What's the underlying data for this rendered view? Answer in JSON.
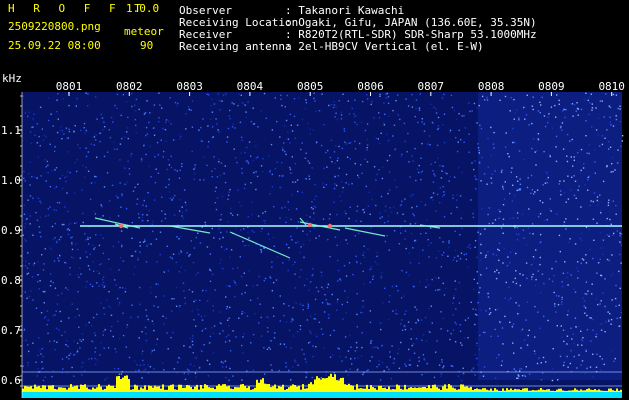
{
  "header": {
    "app_title": "H R O F F T",
    "version": "1.0.0",
    "filename": "2509220800.png",
    "datetime": "25.09.22 08:00",
    "mode": "meteor",
    "count": "90"
  },
  "info": {
    "observer_label": "Observer",
    "observer_value": ": Takanori Kawachi",
    "location_label": "Receiving Location",
    "location_value": ": Ogaki, Gifu, JAPAN (136.60E, 35.35N)",
    "receiver_label": "Receiver",
    "receiver_value": ": R820T2(RTL-SDR) SDR-Sharp 53.1000MHz",
    "antenna_label": "Receiving antenna",
    "antenna_value": ": 2el-HB9CV Vertical (el. E-W)"
  },
  "axes": {
    "y_unit": "kHz",
    "y_ticks": [
      "1.1",
      "1.0",
      "0.9",
      "0.8",
      "0.7",
      "0.6"
    ],
    "x_ticks": [
      "0801",
      "0802",
      "0803",
      "0804",
      "0805",
      "0806",
      "0807",
      "0808",
      "0809",
      "0810"
    ]
  },
  "colors": {
    "background": "#000000",
    "noise": "#0a1f8c",
    "carrier": "#a8ffff",
    "level_bar": "#ffff00",
    "level_base": "#00e0ff"
  }
}
